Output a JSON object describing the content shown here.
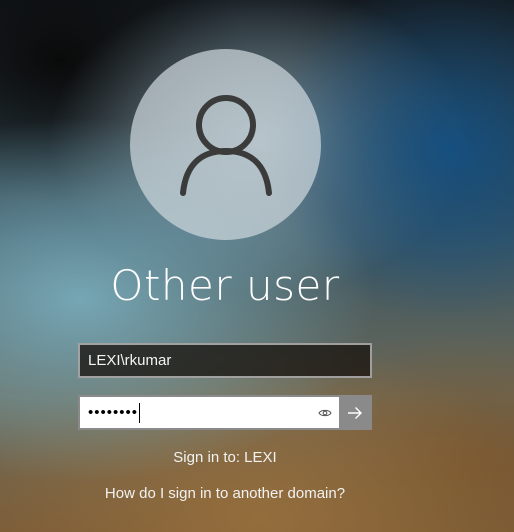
{
  "login": {
    "title": "Other user",
    "username_value": "LEXI\\rkumar",
    "password_masked": "••••••••",
    "sign_in_to": "Sign in to: LEXI",
    "domain_help_link": "How do I sign in to another domain?"
  },
  "icons": {
    "avatar": "user-icon",
    "reveal": "eye-icon",
    "submit": "arrow-right-icon"
  },
  "colors": {
    "avatar_circle": "#cdd7dc",
    "submit_button": "#8a8a8a",
    "text": "#ffffff"
  }
}
